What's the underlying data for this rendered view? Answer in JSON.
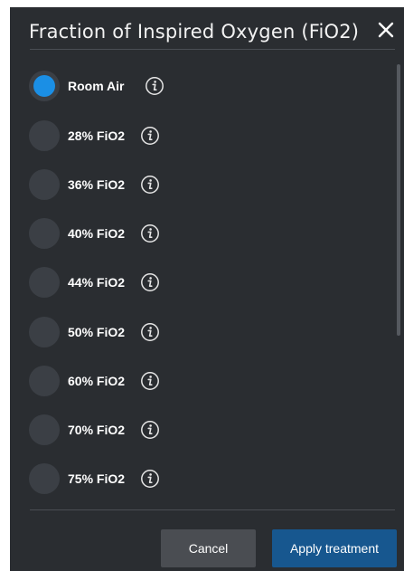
{
  "dialog": {
    "title": "Fraction of Inspired Oxygen (FiO2)",
    "close_icon": "close-icon",
    "colors": {
      "background": "#2a2d31",
      "selected": "#1b8fe5",
      "apply_button": "#17578f",
      "cancel_button": "#4a4d52"
    }
  },
  "options": [
    {
      "label": "Room Air",
      "selected": true,
      "icon": "info-icon"
    },
    {
      "label": "28% FiO2",
      "selected": false,
      "icon": "info-icon"
    },
    {
      "label": "36% FiO2",
      "selected": false,
      "icon": "info-icon"
    },
    {
      "label": "40% FiO2",
      "selected": false,
      "icon": "info-icon"
    },
    {
      "label": "44% FiO2",
      "selected": false,
      "icon": "info-icon"
    },
    {
      "label": "50% FiO2",
      "selected": false,
      "icon": "info-icon"
    },
    {
      "label": "60% FiO2",
      "selected": false,
      "icon": "info-icon"
    },
    {
      "label": "70% FiO2",
      "selected": false,
      "icon": "info-icon"
    },
    {
      "label": "75% FiO2",
      "selected": false,
      "icon": "info-icon"
    }
  ],
  "footer": {
    "cancel_label": "Cancel",
    "apply_label": "Apply treatment"
  }
}
